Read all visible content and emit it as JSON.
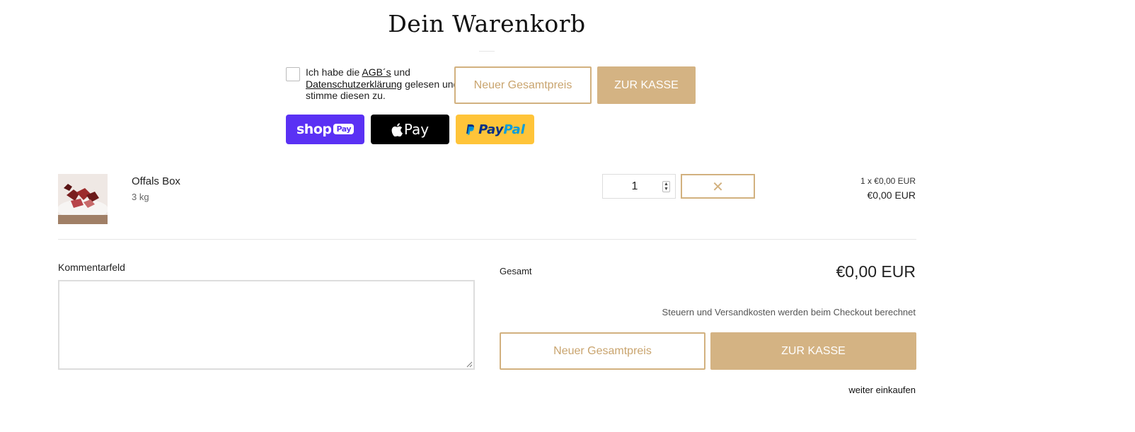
{
  "header": {
    "title": "Dein Warenkorb"
  },
  "agreement": {
    "prefix": "Ich habe die",
    "agb_link": "AGB´s",
    "and": "und",
    "privacy_link": "Datenschutzerklärung",
    "suffix": "gelesen und stimme diesen zu."
  },
  "top_actions": {
    "update_label": "Neuer Gesamtpreis",
    "checkout_label": "ZUR KASSE"
  },
  "payment_buttons": {
    "shoppay": {
      "word": "shop",
      "pill": "Pay"
    },
    "applepay": {
      "word": "Pay"
    },
    "paypal": {
      "word_a": "Pay",
      "word_b": "Pal"
    }
  },
  "cart_item": {
    "name": "Offals Box",
    "variant": "3 kg",
    "quantity": "1",
    "unit_price": "1 x €0,00 EUR",
    "line_price": "€0,00 EUR"
  },
  "comment": {
    "label": "Kommentarfeld",
    "value": ""
  },
  "summary": {
    "total_label": "Gesamt",
    "total_value": "€0,00 EUR",
    "tax_note": "Steuern und Versandkosten werden beim Checkout berechnet",
    "update_label": "Neuer Gesamtpreis",
    "checkout_label": "ZUR KASSE",
    "continue_label": "weiter einkaufen"
  },
  "colors": {
    "accent": "#d4b383",
    "accent_text": "#c9a46e",
    "shoppay": "#5a31f4",
    "applepay": "#000000",
    "paypal": "#ffc439"
  }
}
